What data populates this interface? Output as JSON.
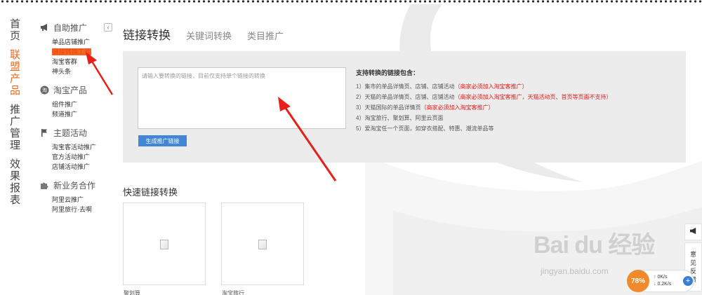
{
  "main_nav": [
    {
      "label": "首页",
      "active": false
    },
    {
      "label": "联盟产品",
      "active": true
    },
    {
      "label": "推广管理",
      "active": false
    },
    {
      "label": "效果报表",
      "active": false
    }
  ],
  "sub_nav": {
    "groups": [
      {
        "icon": "megaphone-icon",
        "title": "自助推广",
        "items": [
          {
            "label": "单品店铺推广",
            "active": false
          },
          {
            "label": "链接转换工具",
            "active": true
          },
          {
            "label": "淘宝客群",
            "active": false
          },
          {
            "label": "神头条",
            "active": false
          }
        ]
      },
      {
        "icon": "taobao-icon",
        "title": "淘宝产品",
        "items": [
          {
            "label": "组件推广",
            "active": false
          },
          {
            "label": "频道推广",
            "active": false
          }
        ]
      },
      {
        "icon": "flag-icon",
        "title": "主题活动",
        "items": [
          {
            "label": "淘宝客活动推广",
            "active": false
          },
          {
            "label": "官方活动推广",
            "active": false
          },
          {
            "label": "店铺活动推广",
            "active": false
          }
        ]
      },
      {
        "icon": "puzzle-icon",
        "title": "新业务合作",
        "items": [
          {
            "label": "阿里云推广",
            "active": false
          },
          {
            "label": "阿里旅行·去啊",
            "active": false
          }
        ]
      }
    ]
  },
  "tabs": [
    {
      "label": "链接转换",
      "active": true
    },
    {
      "label": "关键词转换",
      "active": false
    },
    {
      "label": "类目推广",
      "active": false
    }
  ],
  "converter": {
    "placeholder": "请输入要转换的链接，目前仅支持单个链接的转换",
    "button_label": "生成推广链接",
    "support_title": "支持转换的链接包含：",
    "support_items": [
      {
        "text": "1）集市的单品详情页、店铺、店铺活动",
        "note": "（商家必须加入淘宝客推广）"
      },
      {
        "text": "2）天猫的单品详情页、店铺、店铺活动",
        "note": "（商家必须加入淘宝客推广，天猫活动页、首页等页面不支持）"
      },
      {
        "text": "3）天猫国际的单品详情页",
        "note": "（商家必须加入淘宝客推广）"
      },
      {
        "text": "4）淘宝旅行、聚划算、阿里云页面",
        "note": ""
      },
      {
        "text": "5）爱淘宝任一个页面，如穿衣搭配、特惠、潮流单品等",
        "note": ""
      }
    ]
  },
  "quick": {
    "title": "快速链接转换",
    "cards": [
      {
        "label": "聚划算"
      },
      {
        "label": "淘宝旅行"
      }
    ]
  },
  "side_tools": {
    "feedback_label": "意见反馈"
  },
  "watermark": {
    "main": "Bai du 经验",
    "sub": "jingyan.baidu.com"
  },
  "speed_widget": {
    "percent": "78%",
    "up_rate": "0K/s",
    "down_rate": "0.2K/s",
    "plus": "+"
  },
  "colors": {
    "accent": "#f06a1d",
    "button": "#4187d6",
    "panel_bg": "#ececec",
    "note_red": "#e81b1b",
    "arrow_red": "#e8201a"
  }
}
